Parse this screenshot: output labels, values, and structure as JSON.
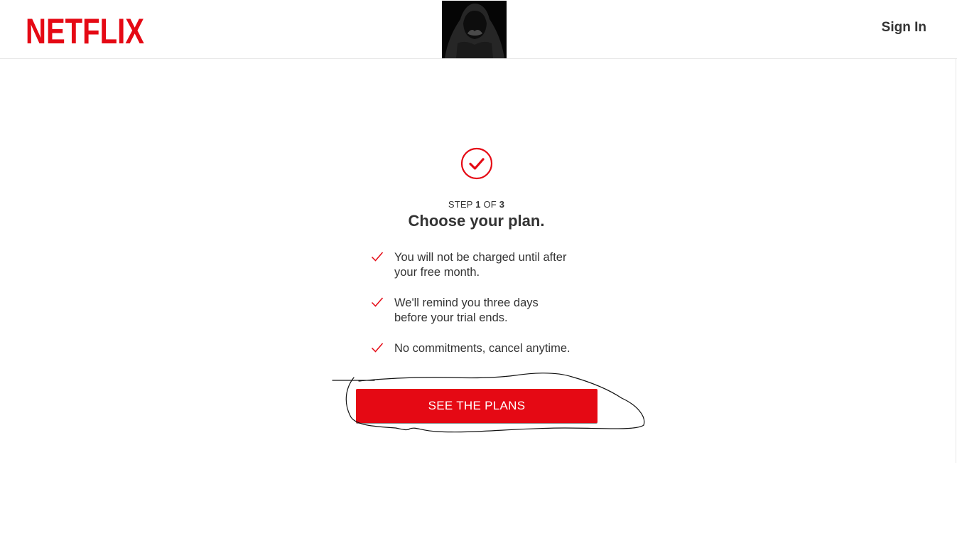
{
  "colors": {
    "brand_red": "#e50914",
    "text": "#333333",
    "header_rule": "#e6e6e6"
  },
  "header": {
    "logo_text": "NETFLIX",
    "profile_image": "hooded-figure-avatar",
    "sign_in_label": "Sign In"
  },
  "main": {
    "status_icon": "check-circle-icon",
    "step": {
      "prefix": "STEP",
      "current": "1",
      "of": "OF",
      "total": "3"
    },
    "title": "Choose your plan.",
    "benefits": [
      {
        "icon": "checkmark-icon",
        "line1": "You will not be charged until after",
        "line2": "your free month."
      },
      {
        "icon": "checkmark-icon",
        "line1": "We'll remind you three days",
        "line2": "before your trial ends."
      },
      {
        "icon": "checkmark-icon",
        "line1": "No commitments, cancel anytime.",
        "line2": ""
      }
    ],
    "cta_label": "SEE THE PLANS"
  }
}
